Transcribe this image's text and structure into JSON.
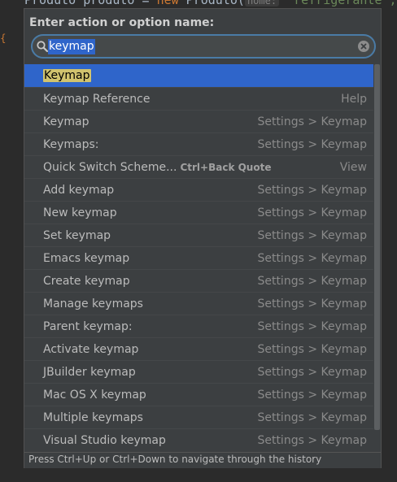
{
  "editor": {
    "code_prefix": "Produto produto = ",
    "code_kw": "new",
    "code_class": " Produto(",
    "code_hint": "nome:",
    "code_str": "\"refrigerante\","
  },
  "popup": {
    "title": "Enter action or option name:",
    "search_value": "keymap",
    "items": [
      {
        "name": "Keymap",
        "category": ""
      },
      {
        "name": "Keymap Reference",
        "category": "Help"
      },
      {
        "name": "Keymap",
        "category": "Settings > Keymap"
      },
      {
        "name": "Keymaps:",
        "category": "Settings > Keymap"
      },
      {
        "name": "Quick Switch Scheme...",
        "shortcut": "Ctrl+Back Quote",
        "category": "View"
      },
      {
        "name": "Add keymap",
        "category": "Settings > Keymap"
      },
      {
        "name": "New keymap",
        "category": "Settings > Keymap"
      },
      {
        "name": "Set keymap",
        "category": "Settings > Keymap"
      },
      {
        "name": "Emacs keymap",
        "category": "Settings > Keymap"
      },
      {
        "name": "Create keymap",
        "category": "Settings > Keymap"
      },
      {
        "name": "Manage keymaps",
        "category": "Settings > Keymap"
      },
      {
        "name": "Parent keymap:",
        "category": "Settings > Keymap"
      },
      {
        "name": "Activate keymap",
        "category": "Settings > Keymap"
      },
      {
        "name": "JBuilder keymap",
        "category": "Settings > Keymap"
      },
      {
        "name": "Mac OS X keymap",
        "category": "Settings > Keymap"
      },
      {
        "name": "Multiple keymaps",
        "category": "Settings > Keymap"
      },
      {
        "name": "Visual Studio keymap",
        "category": "Settings > Keymap"
      }
    ],
    "status": "Press Ctrl+Up or Ctrl+Down to navigate through the history"
  },
  "colors": {
    "selection": "#2f65ca",
    "highlight": "#d1c36e",
    "search_border": "#4a7ba6"
  }
}
